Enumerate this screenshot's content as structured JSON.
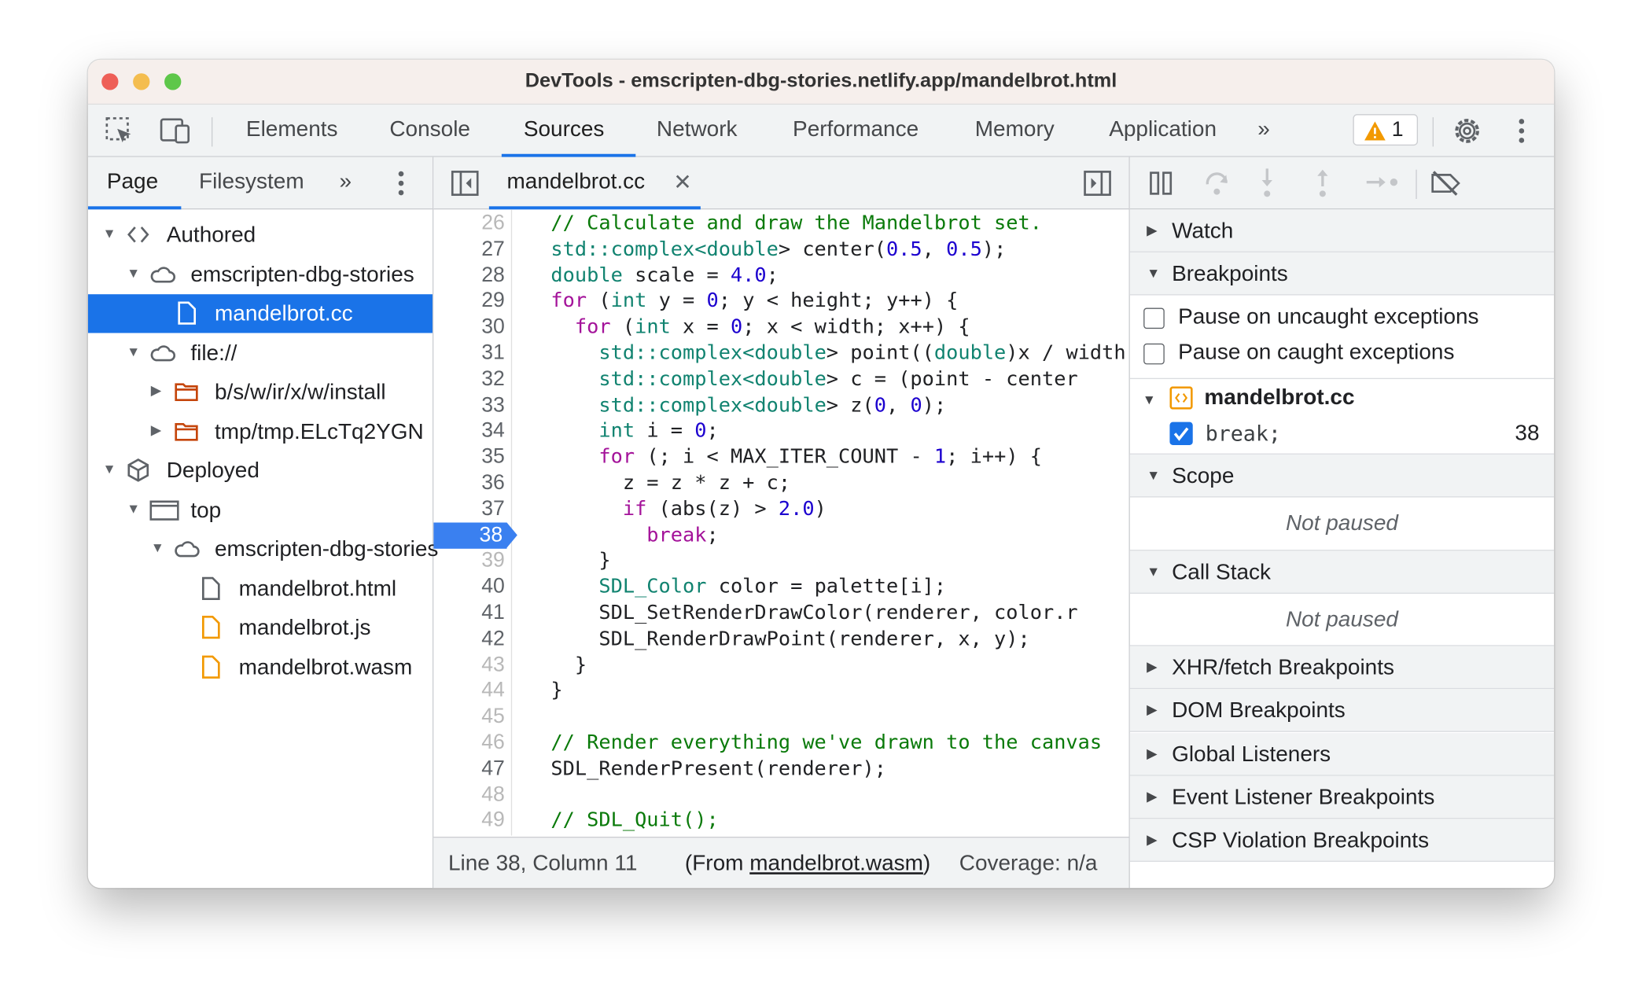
{
  "window": {
    "title": "DevTools - emscripten-dbg-stories.netlify.app/mandelbrot.html"
  },
  "toolbar": {
    "tabs": [
      "Elements",
      "Console",
      "Sources",
      "Network",
      "Performance",
      "Memory",
      "Application"
    ],
    "active_tab": "Sources",
    "more": "»",
    "warning_count": "1"
  },
  "navigator": {
    "tabs": [
      "Page",
      "Filesystem"
    ],
    "more": "»",
    "tree": [
      {
        "label": "Authored",
        "depth": 0,
        "arrow": "down",
        "icon": "code-icon"
      },
      {
        "label": "emscripten-dbg-stories",
        "depth": 1,
        "arrow": "down",
        "icon": "cloud-icon"
      },
      {
        "label": "mandelbrot.cc",
        "depth": 2,
        "arrow": "",
        "icon": "file-icon",
        "selected": true
      },
      {
        "label": "file://",
        "depth": 1,
        "arrow": "down",
        "icon": "cloud-icon"
      },
      {
        "label": "b/s/w/ir/x/w/install",
        "depth": 2,
        "arrow": "right",
        "icon": "folder-icon"
      },
      {
        "label": "tmp/tmp.ELcTq2YGN",
        "depth": 2,
        "arrow": "right",
        "icon": "folder-icon"
      },
      {
        "label": "Deployed",
        "depth": 0,
        "arrow": "down",
        "icon": "box-icon"
      },
      {
        "label": "top",
        "depth": 1,
        "arrow": "down",
        "icon": "frame-icon"
      },
      {
        "label": "emscripten-dbg-stories",
        "depth": 2,
        "arrow": "down",
        "icon": "cloud-icon"
      },
      {
        "label": "mandelbrot.html",
        "depth": 3,
        "arrow": "",
        "icon": "file-icon"
      },
      {
        "label": "mandelbrot.js",
        "depth": 3,
        "arrow": "",
        "icon": "file-orange-icon"
      },
      {
        "label": "mandelbrot.wasm",
        "depth": 3,
        "arrow": "",
        "icon": "file-orange-icon"
      }
    ]
  },
  "editor": {
    "tab_label": "mandelbrot.cc",
    "breakpoint_line": 38,
    "lines": [
      {
        "n": 26,
        "dim": true,
        "tokens": [
          [
            "c",
            "// Calculate and draw the Mandelbrot set."
          ]
        ]
      },
      {
        "n": 27,
        "tokens": [
          [
            "t",
            "std::complex<double"
          ],
          [
            "p",
            "> center("
          ],
          [
            "n",
            "0.5"
          ],
          [
            "p",
            ", "
          ],
          [
            "n",
            "0.5"
          ],
          [
            "p",
            ");"
          ]
        ]
      },
      {
        "n": 28,
        "tokens": [
          [
            "t",
            "double"
          ],
          [
            "p",
            " scale = "
          ],
          [
            "n",
            "4.0"
          ],
          [
            "p",
            ";"
          ]
        ]
      },
      {
        "n": 29,
        "tokens": [
          [
            "k",
            "for"
          ],
          [
            "p",
            " ("
          ],
          [
            "t",
            "int"
          ],
          [
            "p",
            " y = "
          ],
          [
            "n",
            "0"
          ],
          [
            "p",
            "; y < height; y++) {"
          ]
        ]
      },
      {
        "n": 30,
        "tokens": [
          [
            "p",
            "  "
          ],
          [
            "k",
            "for"
          ],
          [
            "p",
            " ("
          ],
          [
            "t",
            "int"
          ],
          [
            "p",
            " x = "
          ],
          [
            "n",
            "0"
          ],
          [
            "p",
            "; x < width; x++) {"
          ]
        ]
      },
      {
        "n": 31,
        "tokens": [
          [
            "p",
            "    "
          ],
          [
            "t",
            "std::complex<double"
          ],
          [
            "p",
            "> point(("
          ],
          [
            "t",
            "double"
          ],
          [
            "p",
            ")x / width"
          ]
        ]
      },
      {
        "n": 32,
        "tokens": [
          [
            "p",
            "    "
          ],
          [
            "t",
            "std::complex<double"
          ],
          [
            "p",
            "> c = (point - center"
          ]
        ]
      },
      {
        "n": 33,
        "tokens": [
          [
            "p",
            "    "
          ],
          [
            "t",
            "std::complex<double"
          ],
          [
            "p",
            "> z("
          ],
          [
            "n",
            "0"
          ],
          [
            "p",
            ", "
          ],
          [
            "n",
            "0"
          ],
          [
            "p",
            ");"
          ]
        ]
      },
      {
        "n": 34,
        "tokens": [
          [
            "p",
            "    "
          ],
          [
            "t",
            "int"
          ],
          [
            "p",
            " i = "
          ],
          [
            "n",
            "0"
          ],
          [
            "p",
            ";"
          ]
        ]
      },
      {
        "n": 35,
        "tokens": [
          [
            "p",
            "    "
          ],
          [
            "k",
            "for"
          ],
          [
            "p",
            " (; i < MAX_ITER_COUNT - "
          ],
          [
            "n",
            "1"
          ],
          [
            "p",
            "; i++) {"
          ]
        ]
      },
      {
        "n": 36,
        "tokens": [
          [
            "p",
            "      z = z * z + c;"
          ]
        ]
      },
      {
        "n": 37,
        "tokens": [
          [
            "p",
            "      "
          ],
          [
            "k",
            "if"
          ],
          [
            "p",
            " (abs(z) > "
          ],
          [
            "n",
            "2.0"
          ],
          [
            "p",
            ")"
          ]
        ]
      },
      {
        "n": 38,
        "tokens": [
          [
            "p",
            "        "
          ],
          [
            "k",
            "break"
          ],
          [
            "p",
            ";"
          ]
        ]
      },
      {
        "n": 39,
        "dim": true,
        "tokens": [
          [
            "p",
            "    }"
          ]
        ]
      },
      {
        "n": 40,
        "tokens": [
          [
            "p",
            "    "
          ],
          [
            "t",
            "SDL_Color"
          ],
          [
            "p",
            " color = palette[i];"
          ]
        ]
      },
      {
        "n": 41,
        "tokens": [
          [
            "p",
            "    SDL_SetRenderDrawColor(renderer, color.r"
          ]
        ]
      },
      {
        "n": 42,
        "tokens": [
          [
            "p",
            "    SDL_RenderDrawPoint(renderer, x, y);"
          ]
        ]
      },
      {
        "n": 43,
        "dim": true,
        "tokens": [
          [
            "p",
            "  }"
          ]
        ]
      },
      {
        "n": 44,
        "dim": true,
        "tokens": [
          [
            "p",
            "}"
          ]
        ]
      },
      {
        "n": 45,
        "dim": true,
        "tokens": []
      },
      {
        "n": 46,
        "dim": true,
        "tokens": [
          [
            "c",
            "// Render everything we've drawn to the canvas"
          ]
        ]
      },
      {
        "n": 47,
        "tokens": [
          [
            "p",
            "SDL_RenderPresent(renderer);"
          ]
        ]
      },
      {
        "n": 48,
        "dim": true,
        "tokens": []
      },
      {
        "n": 49,
        "dim": true,
        "tokens": [
          [
            "c",
            "// SDL_Quit();"
          ]
        ]
      }
    ],
    "status": {
      "position": "Line 38, Column 11",
      "from_prefix": "(From ",
      "from_link": "mandelbrot.wasm",
      "from_suffix": ")",
      "coverage": "Coverage: n/a"
    }
  },
  "debugger": {
    "watch": "Watch",
    "breakpoints": "Breakpoints",
    "pause_uncaught": "Pause on uncaught exceptions",
    "pause_caught": "Pause on caught exceptions",
    "bp_file": "mandelbrot.cc",
    "bp_code": "break;",
    "bp_line": "38",
    "scope": "Scope",
    "scope_status": "Not paused",
    "call_stack": "Call Stack",
    "call_stack_status": "Not paused",
    "collapsed": [
      "XHR/fetch Breakpoints",
      "DOM Breakpoints",
      "Global Listeners",
      "Event Listener Breakpoints",
      "CSP Violation Breakpoints"
    ]
  },
  "colors": {
    "accent": "#1a73e8",
    "comment": "#0a7a0a",
    "keyword": "#a4139a",
    "type": "#118370",
    "number": "#1c00cf"
  }
}
